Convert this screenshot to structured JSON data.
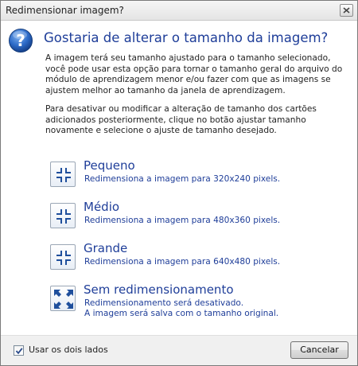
{
  "window": {
    "title": "Redimensionar imagem?",
    "accent": "#1f3e99"
  },
  "main": {
    "heading": "Gostaria de alterar o tamanho da imagem?",
    "paragraph1": "A imagem terá seu tamanho ajustado para o tamanho selecionado, você pode usar esta opção para tornar o tamanho geral do arquivo do módulo de aprendizagem menor e/ou fazer com que as imagens se ajustem melhor ao tamanho da janela de aprendizagem.",
    "paragraph2": "Para desativar ou modificar a alteração de tamanho dos cartões adicionados posteriormente, clique no botão ajustar tamanho novamente e selecione o ajuste de tamanho desejado."
  },
  "options": [
    {
      "label": "Pequeno",
      "description": "Redimensiona a imagem para 320x240 pixels.",
      "icon": "shrink-arrows-icon"
    },
    {
      "label": "Médio",
      "description": "Redimensiona a imagem para 480x360 pixels.",
      "icon": "shrink-arrows-icon"
    },
    {
      "label": "Grande",
      "description": "Redimensiona a imagem para 640x480 pixels.",
      "icon": "shrink-arrows-icon"
    },
    {
      "label": "Sem redimensionamento",
      "description": "Redimensionamento será desativado.",
      "description2": "A imagem será salva com o tamanho original.",
      "icon": "expand-arrows-icon"
    }
  ],
  "footer": {
    "checkbox_label": "Usar os dois lados",
    "checkbox_checked": true,
    "cancel_label": "Cancelar"
  }
}
